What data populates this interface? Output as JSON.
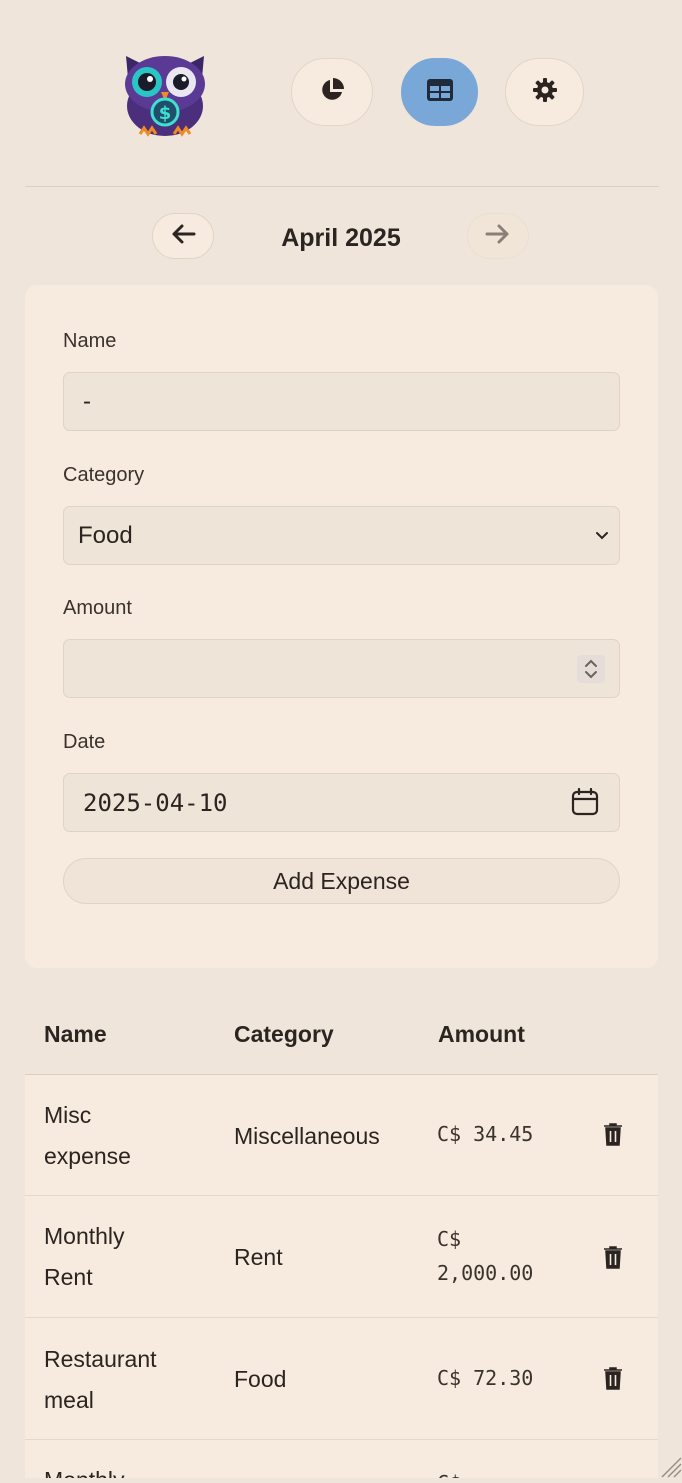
{
  "header": {
    "nav": [
      {
        "icon": "pie-chart-icon",
        "active": false
      },
      {
        "icon": "table-icon",
        "active": true
      },
      {
        "icon": "gear-icon",
        "active": false
      }
    ]
  },
  "month_nav": {
    "label": "April 2025"
  },
  "form": {
    "name_label": "Name",
    "name_value": "-",
    "category_label": "Category",
    "category_value": "Food",
    "amount_label": "Amount",
    "amount_value": "",
    "date_label": "Date",
    "date_value": "2025-04-10",
    "submit_label": "Add Expense"
  },
  "table": {
    "headers": [
      "Name",
      "Category",
      "Amount"
    ],
    "rows": [
      {
        "name_line1": "Misc",
        "name_line2": "expense",
        "category": "Miscellaneous",
        "amount_line1": "C$ 34.45",
        "amount_line2": ""
      },
      {
        "name_line1": "Monthly",
        "name_line2": "Rent",
        "category": "Rent",
        "amount_line1": "C$",
        "amount_line2": "2,000.00"
      },
      {
        "name_line1": "Restaurant",
        "name_line2": "meal",
        "category": "Food",
        "amount_line1": "C$ 72.30",
        "amount_line2": ""
      },
      {
        "name_line1": "Monthly",
        "name_line2": "",
        "category": "",
        "amount_line1": "C$",
        "amount_line2": ""
      }
    ]
  },
  "colors": {
    "background": "#efe5da",
    "card": "#f7ebdf",
    "active_nav": "#79a7d8"
  }
}
